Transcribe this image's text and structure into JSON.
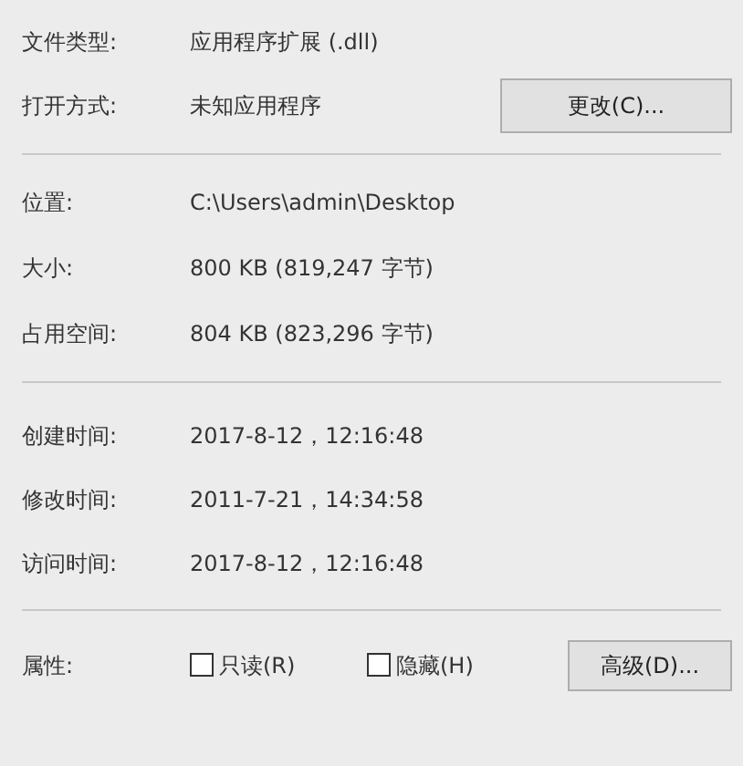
{
  "file_section": [
    {
      "label": "文件类型:",
      "value": "应用程序扩展 (.dll)"
    },
    {
      "label": "打开方式:",
      "value": "未知应用程序",
      "button": "更改(C)..."
    }
  ],
  "size_section": [
    {
      "label": "位置:",
      "value": "C:\\Users\\admin\\Desktop"
    },
    {
      "label": "大小:",
      "value": "800 KB (819,247 字节)"
    },
    {
      "label": "占用空间:",
      "value": "804 KB (823,296 字节)"
    }
  ],
  "time_section": [
    {
      "label": "创建时间:",
      "value": "2017-8-12，12:16:48"
    },
    {
      "label": "修改时间:",
      "value": "2011-7-21，14:34:58"
    },
    {
      "label": "访问时间:",
      "value": "2017-8-12，12:16:48"
    }
  ],
  "attributes": {
    "label": "属性:",
    "checkboxes": [
      {
        "label": "只读(R)",
        "checked": false
      },
      {
        "label": "隐藏(H)",
        "checked": false
      }
    ],
    "button": "高级(D)..."
  }
}
